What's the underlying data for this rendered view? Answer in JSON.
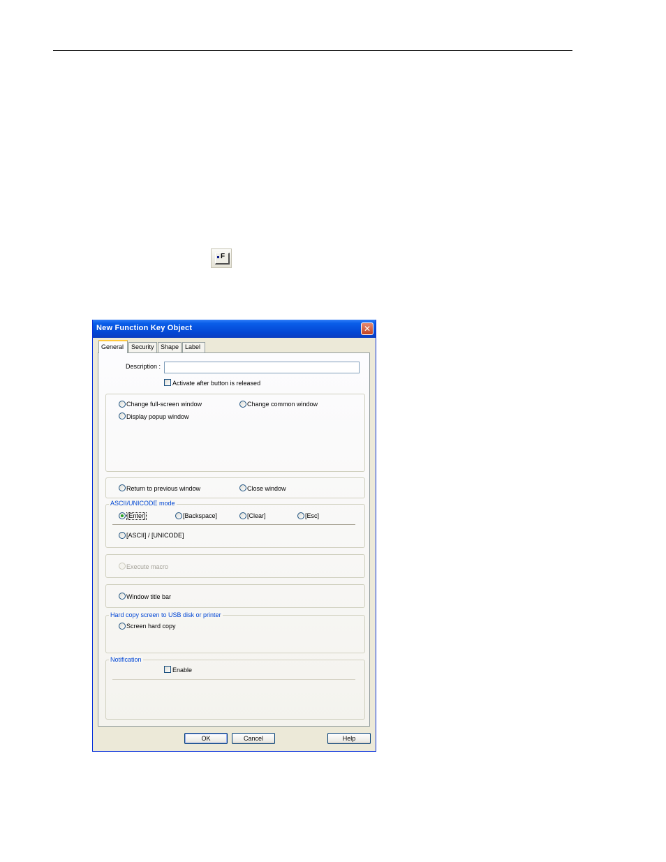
{
  "toolbar": {
    "function_key_icon": "function-key-icon",
    "function_key_letter": "F"
  },
  "dialog": {
    "title": "New  Function Key Object",
    "close_glyph": "✕",
    "tabs": [
      "General",
      "Security",
      "Shape",
      "Label"
    ],
    "description_label": "Description :",
    "description_value": "",
    "activate_after_release": "Activate after button is released",
    "window_group": {
      "change_full_screen": "Change full-screen window",
      "change_common": "Change common window",
      "display_popup": "Display popup window"
    },
    "return_previous": "Return to previous window",
    "close_window": "Close window",
    "ascii_group": {
      "legend": "ASCII/UNICODE mode",
      "enter": "[Enter]",
      "backspace": "[Backspace]",
      "clear": "[Clear]",
      "esc": "[Esc]",
      "ascii_unicode": "[ASCII] / [UNICODE]"
    },
    "execute_macro": "Execute macro",
    "window_title_bar": "Window title bar",
    "hardcopy_group": {
      "legend": "Hard copy screen to USB disk or printer",
      "screen_hard_copy": "Screen hard copy"
    },
    "notification_group": {
      "legend": "Notification",
      "enable": "Enable"
    },
    "buttons": {
      "ok": "OK",
      "cancel": "Cancel",
      "help": "Help"
    }
  }
}
